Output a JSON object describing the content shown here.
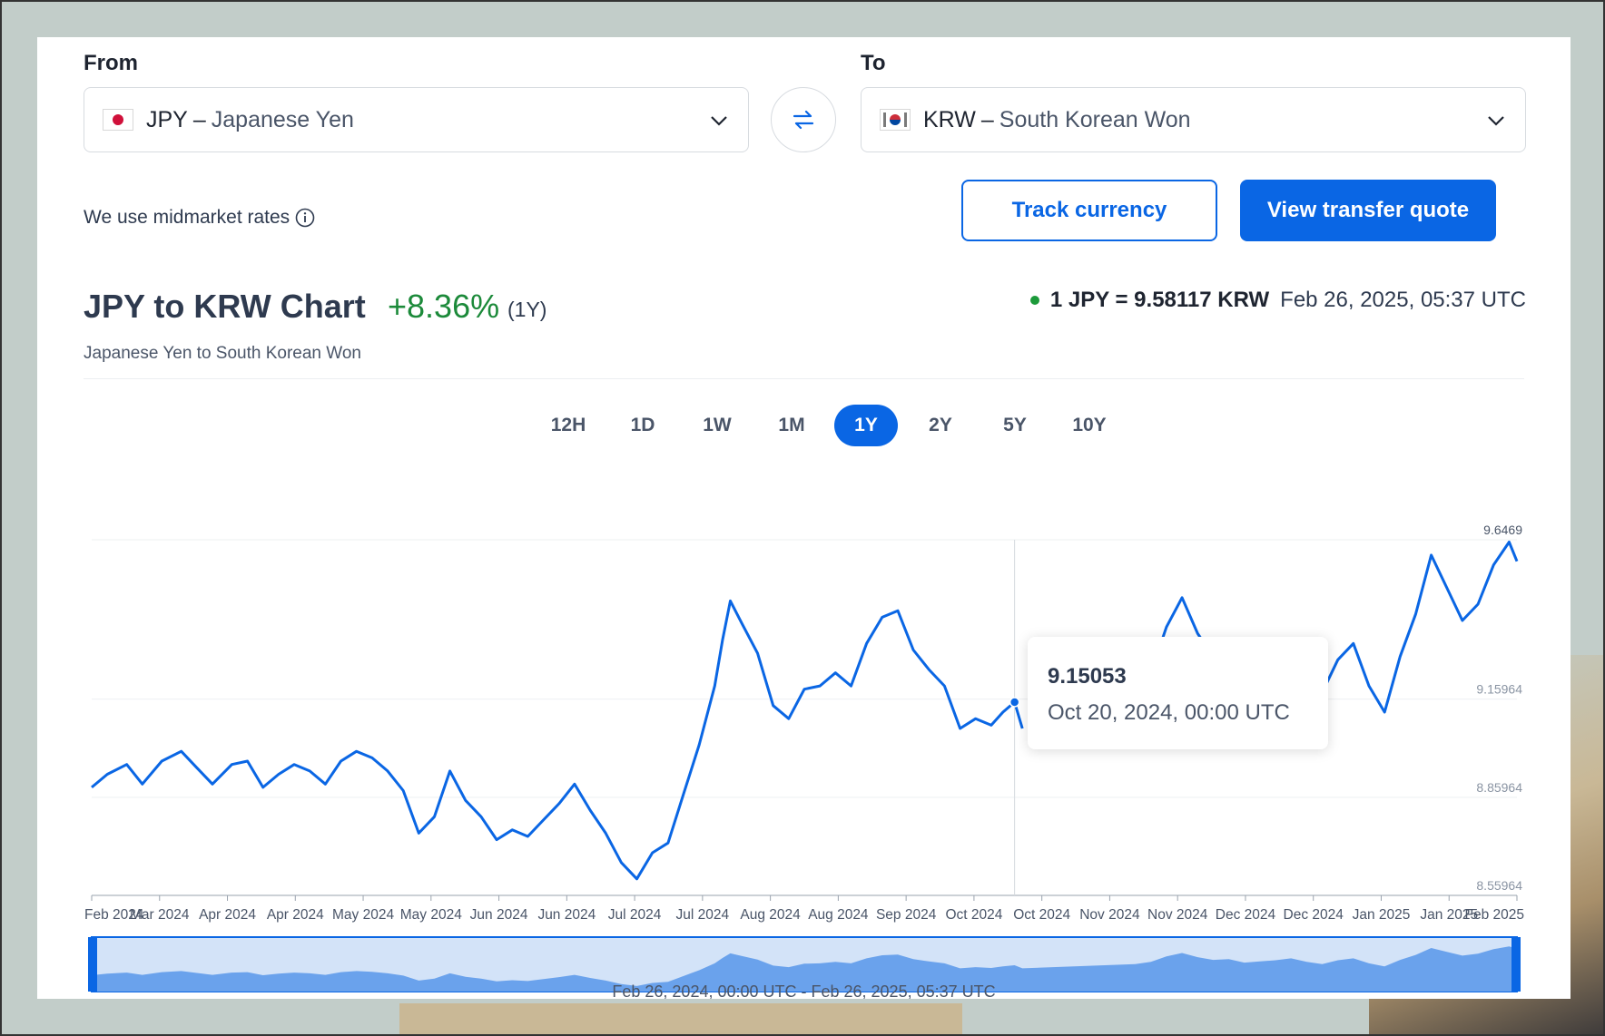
{
  "from": {
    "label": "From",
    "code": "JPY",
    "separator": "–",
    "name": "Japanese Yen"
  },
  "to": {
    "label": "To",
    "code": "KRW",
    "separator": "–",
    "name": "South Korean Won"
  },
  "midmarket_text": "We use midmarket rates",
  "buttons": {
    "track": "Track currency",
    "quote": "View transfer quote"
  },
  "header": {
    "title": "JPY to KRW Chart",
    "change": "+8.36%",
    "period": "(1Y)",
    "subtitle": "Japanese Yen to South Korean Won",
    "rate": "1 JPY = 9.58117 KRW",
    "rate_time": "Feb 26, 2025, 05:37 UTC"
  },
  "periods": [
    "12H",
    "1D",
    "1W",
    "1M",
    "1Y",
    "2Y",
    "5Y",
    "10Y"
  ],
  "active_period": "1Y",
  "tooltip": {
    "value": "9.15053",
    "date": "Oct 20, 2024, 00:00 UTC"
  },
  "range_text": "Feb 26, 2024, 00:00 UTC - Feb 26, 2025, 05:37 UTC",
  "colors": {
    "accent": "#0a66e4",
    "positive": "#1c8a3a",
    "line": "#0a66e4"
  },
  "chart_data": {
    "type": "line",
    "title": "JPY to KRW Chart",
    "x_tick_labels": [
      "Feb 2024",
      "Mar 2024",
      "Apr 2024",
      "Apr 2024",
      "May 2024",
      "May 2024",
      "Jun 2024",
      "Jun 2024",
      "Jul 2024",
      "Jul 2024",
      "Aug 2024",
      "Aug 2024",
      "Sep 2024",
      "Oct 2024",
      "Oct 2024",
      "Nov 2024",
      "Nov 2024",
      "Dec 2024",
      "Dec 2024",
      "Jan 2025",
      "Jan 2025",
      "Feb 2025"
    ],
    "y_tick_labels": [
      "9.6469",
      "9.15964",
      "8.85964",
      "8.55964"
    ],
    "ylim": [
      8.55964,
      9.6469
    ],
    "grid": true,
    "highlight": {
      "x": "2024-10-20",
      "y": 9.15053
    },
    "series": [
      {
        "values": [
          [
            "2024-02-26",
            8.89
          ],
          [
            "2024-03-01",
            8.93
          ],
          [
            "2024-03-06",
            8.96
          ],
          [
            "2024-03-10",
            8.9
          ],
          [
            "2024-03-15",
            8.97
          ],
          [
            "2024-03-20",
            9.0
          ],
          [
            "2024-03-24",
            8.95
          ],
          [
            "2024-03-28",
            8.9
          ],
          [
            "2024-04-02",
            8.96
          ],
          [
            "2024-04-06",
            8.97
          ],
          [
            "2024-04-10",
            8.89
          ],
          [
            "2024-04-14",
            8.93
          ],
          [
            "2024-04-18",
            8.96
          ],
          [
            "2024-04-22",
            8.94
          ],
          [
            "2024-04-26",
            8.9
          ],
          [
            "2024-04-30",
            8.97
          ],
          [
            "2024-05-04",
            9.0
          ],
          [
            "2024-05-08",
            8.98
          ],
          [
            "2024-05-12",
            8.94
          ],
          [
            "2024-05-16",
            8.88
          ],
          [
            "2024-05-20",
            8.75
          ],
          [
            "2024-05-24",
            8.8
          ],
          [
            "2024-05-28",
            8.94
          ],
          [
            "2024-06-01",
            8.85
          ],
          [
            "2024-06-05",
            8.8
          ],
          [
            "2024-06-09",
            8.73
          ],
          [
            "2024-06-13",
            8.76
          ],
          [
            "2024-06-17",
            8.74
          ],
          [
            "2024-06-21",
            8.79
          ],
          [
            "2024-06-25",
            8.84
          ],
          [
            "2024-06-29",
            8.9
          ],
          [
            "2024-07-03",
            8.82
          ],
          [
            "2024-07-07",
            8.75
          ],
          [
            "2024-07-11",
            8.66
          ],
          [
            "2024-07-15",
            8.61
          ],
          [
            "2024-07-19",
            8.69
          ],
          [
            "2024-07-23",
            8.72
          ],
          [
            "2024-07-27",
            8.87
          ],
          [
            "2024-07-31",
            9.02
          ],
          [
            "2024-08-04",
            9.2
          ],
          [
            "2024-08-06",
            9.34
          ],
          [
            "2024-08-08",
            9.46
          ],
          [
            "2024-08-11",
            9.39
          ],
          [
            "2024-08-15",
            9.3
          ],
          [
            "2024-08-19",
            9.14
          ],
          [
            "2024-08-23",
            9.1
          ],
          [
            "2024-08-27",
            9.19
          ],
          [
            "2024-08-31",
            9.2
          ],
          [
            "2024-09-04",
            9.24
          ],
          [
            "2024-09-08",
            9.2
          ],
          [
            "2024-09-12",
            9.33
          ],
          [
            "2024-09-16",
            9.41
          ],
          [
            "2024-09-20",
            9.43
          ],
          [
            "2024-09-24",
            9.31
          ],
          [
            "2024-09-28",
            9.25
          ],
          [
            "2024-10-02",
            9.2
          ],
          [
            "2024-10-06",
            9.07
          ],
          [
            "2024-10-10",
            9.1
          ],
          [
            "2024-10-14",
            9.08
          ],
          [
            "2024-10-17",
            9.12
          ],
          [
            "2024-10-20",
            9.15053
          ],
          [
            "2024-10-22",
            9.07
          ]
        ]
      },
      {
        "values": [
          [
            "2024-11-20",
            9.18
          ],
          [
            "2024-11-24",
            9.24
          ],
          [
            "2024-11-28",
            9.38
          ],
          [
            "2024-12-02",
            9.47
          ],
          [
            "2024-12-06",
            9.36
          ],
          [
            "2024-12-10",
            9.29
          ],
          [
            "2024-12-14",
            9.31
          ],
          [
            "2024-12-18",
            9.22
          ],
          [
            "2024-12-22",
            9.25
          ],
          [
            "2024-12-26",
            9.28
          ],
          [
            "2024-12-30",
            9.33
          ],
          [
            "2025-01-03",
            9.24
          ],
          [
            "2025-01-07",
            9.18
          ],
          [
            "2025-01-11",
            9.28
          ],
          [
            "2025-01-15",
            9.33
          ],
          [
            "2025-01-19",
            9.2
          ],
          [
            "2025-01-23",
            9.12
          ],
          [
            "2025-01-27",
            9.29
          ],
          [
            "2025-01-31",
            9.42
          ],
          [
            "2025-02-04",
            9.6
          ],
          [
            "2025-02-08",
            9.5
          ],
          [
            "2025-02-12",
            9.4
          ],
          [
            "2025-02-16",
            9.45
          ],
          [
            "2025-02-20",
            9.57
          ],
          [
            "2025-02-24",
            9.64
          ],
          [
            "2025-02-26",
            9.58117
          ]
        ]
      }
    ]
  }
}
